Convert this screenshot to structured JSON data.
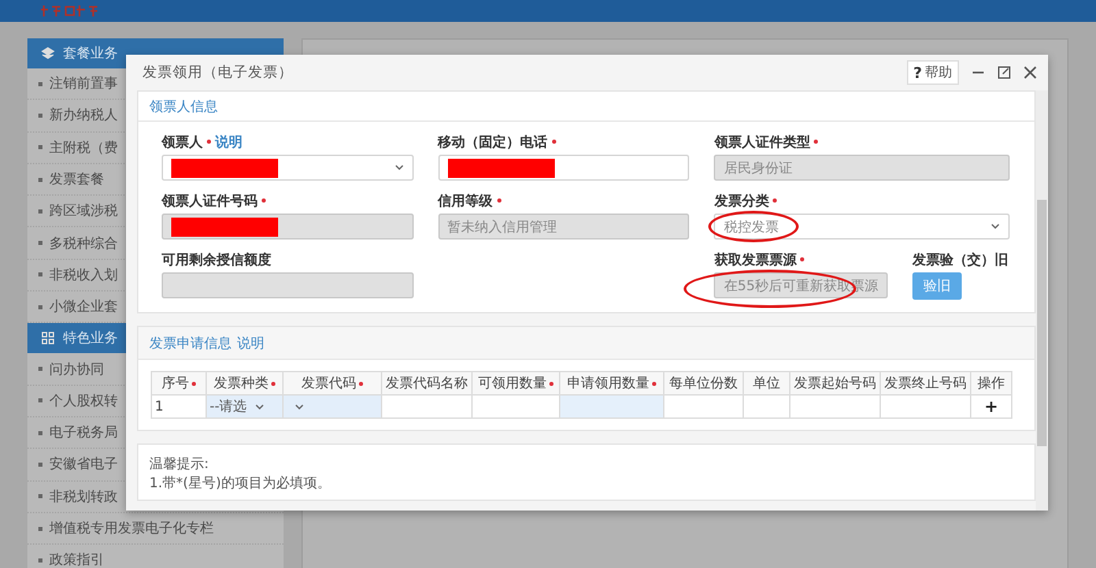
{
  "sidebar": {
    "groups": [
      {
        "title": "套餐业务",
        "items": [
          "注销前置事",
          "新办纳税人",
          "主附税（费",
          "发票套餐",
          "跨区域涉税",
          "多税种综合",
          "非税收入划",
          "小微企业套"
        ]
      },
      {
        "title": "特色业务",
        "items": [
          "问办协同",
          "个人股权转",
          "电子税务局",
          "安徽省电子",
          "非税划转政",
          "增值税专用发票电子化专栏",
          "政策指引"
        ]
      }
    ]
  },
  "dialog": {
    "title": "发票领用（电子发票）",
    "help_mark": "?",
    "help_label": "帮助",
    "applicant": {
      "title": "领票人信息",
      "fields": [
        {
          "kind": "select",
          "label": "领票人",
          "required": true,
          "link": "说明",
          "redacted": true,
          "disabled": false
        },
        {
          "kind": "text",
          "label": "移动（固定）电话",
          "required": true,
          "redacted": true,
          "disabled": false
        },
        {
          "kind": "text",
          "label": "领票人证件类型",
          "required": true,
          "value": "居民身份证",
          "disabled": true
        },
        {
          "kind": "text",
          "label": "领票人证件号码",
          "required": true,
          "redacted": true,
          "disabled": true
        },
        {
          "kind": "text",
          "label": "信用等级",
          "required": true,
          "value": "暂未纳入信用管理",
          "disabled": true
        },
        {
          "kind": "select",
          "label": "发票分类",
          "required": true,
          "value": "税控发票",
          "disabled": false,
          "circled": true
        },
        {
          "kind": "text",
          "label": "可用剩余授信额度",
          "required": false,
          "disabled": true
        },
        {
          "kind": "narrow",
          "label": "获取发票票源",
          "required": true,
          "value": "在55秒后可重新获取票源",
          "disabled": true,
          "circled": true
        },
        {
          "kind": "button",
          "label": "发票验（交）旧",
          "required": false,
          "button": "验旧"
        }
      ]
    },
    "request": {
      "title": "发票申请信息",
      "link": "说明",
      "columns": [
        {
          "label": "序号",
          "required": true
        },
        {
          "label": "发票种类",
          "required": true
        },
        {
          "label": "发票代码",
          "required": true
        },
        {
          "label": "发票代码名称",
          "required": false
        },
        {
          "label": "可领用数量",
          "required": true
        },
        {
          "label": "申请领用数量",
          "required": true
        },
        {
          "label": "每单位份数",
          "required": false
        },
        {
          "label": "单位",
          "required": false
        },
        {
          "label": "发票起始号码",
          "required": false
        },
        {
          "label": "发票终止号码",
          "required": false
        },
        {
          "label": "操作",
          "required": false
        }
      ],
      "rows": [
        [
          {
            "kind": "text",
            "text": "1"
          },
          {
            "kind": "select",
            "text": "--请选"
          },
          {
            "kind": "select",
            "text": ""
          },
          {
            "kind": "text",
            "text": ""
          },
          {
            "kind": "text",
            "text": ""
          },
          {
            "kind": "input",
            "text": ""
          },
          {
            "kind": "text",
            "text": ""
          },
          {
            "kind": "text",
            "text": ""
          },
          {
            "kind": "text",
            "text": ""
          },
          {
            "kind": "text",
            "text": ""
          },
          {
            "kind": "add",
            "text": "+"
          }
        ]
      ]
    },
    "notes": {
      "title": "温馨提示:",
      "lines": [
        "1.带*(星号)的项目为必填项。"
      ]
    }
  }
}
